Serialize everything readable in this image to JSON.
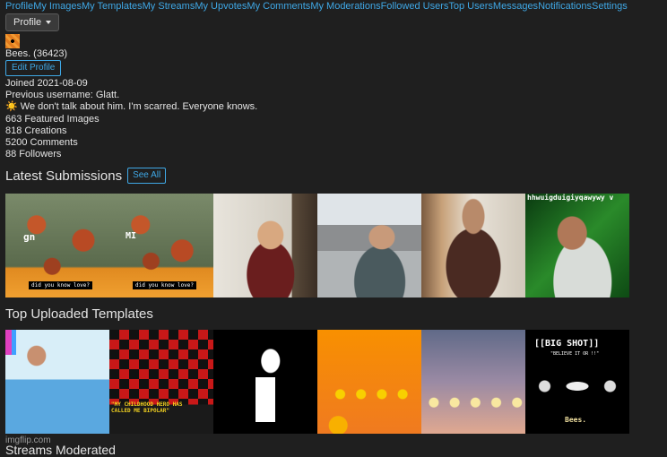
{
  "nav": [
    "Profile",
    "My Images",
    "My Templates",
    "My Streams",
    "My Upvotes",
    "My Comments",
    "My Moderations",
    "Followed Users",
    "Top Users",
    "Messages",
    "Notifications",
    "Settings"
  ],
  "profile_menu_label": "Profile",
  "user": {
    "name": "Bees. (36423)",
    "edit_label": "Edit Profile",
    "joined": "Joined 2021-08-09",
    "previous_username": "Previous username: Glatt.",
    "bio": "We don't talk about him. I'm scarred. Everyone knows.",
    "featured": "663 Featured Images",
    "creations": "818 Creations",
    "comments": "5200 Comments",
    "followers": "88 Followers"
  },
  "latest": {
    "title": "Latest Submissions",
    "see_all": "See All",
    "items": [
      {
        "caption": "gn",
        "sub": "did you know love?"
      },
      {
        "caption": "MI",
        "sub": "did you know love?"
      },
      {
        "caption": ""
      },
      {
        "caption": ""
      },
      {
        "caption": ""
      },
      {
        "caption": "hhwuigduigiyqawywy v"
      }
    ]
  },
  "templates": {
    "title": "Top Uploaded Templates",
    "items": [
      {
        "caption": ""
      },
      {
        "caption": "\"MY CHILDHOOD HERO HAS CALLED ME BIPOLAR\""
      },
      {
        "caption": ""
      },
      {
        "caption": ""
      },
      {
        "caption": ""
      },
      {
        "caption": "[[BIG SHOT]]",
        "sub": "\"BELIEVE IT OR !!\"",
        "foot": "Bees."
      }
    ]
  },
  "footer": "imgflip.com",
  "next_section": "Streams Moderated"
}
